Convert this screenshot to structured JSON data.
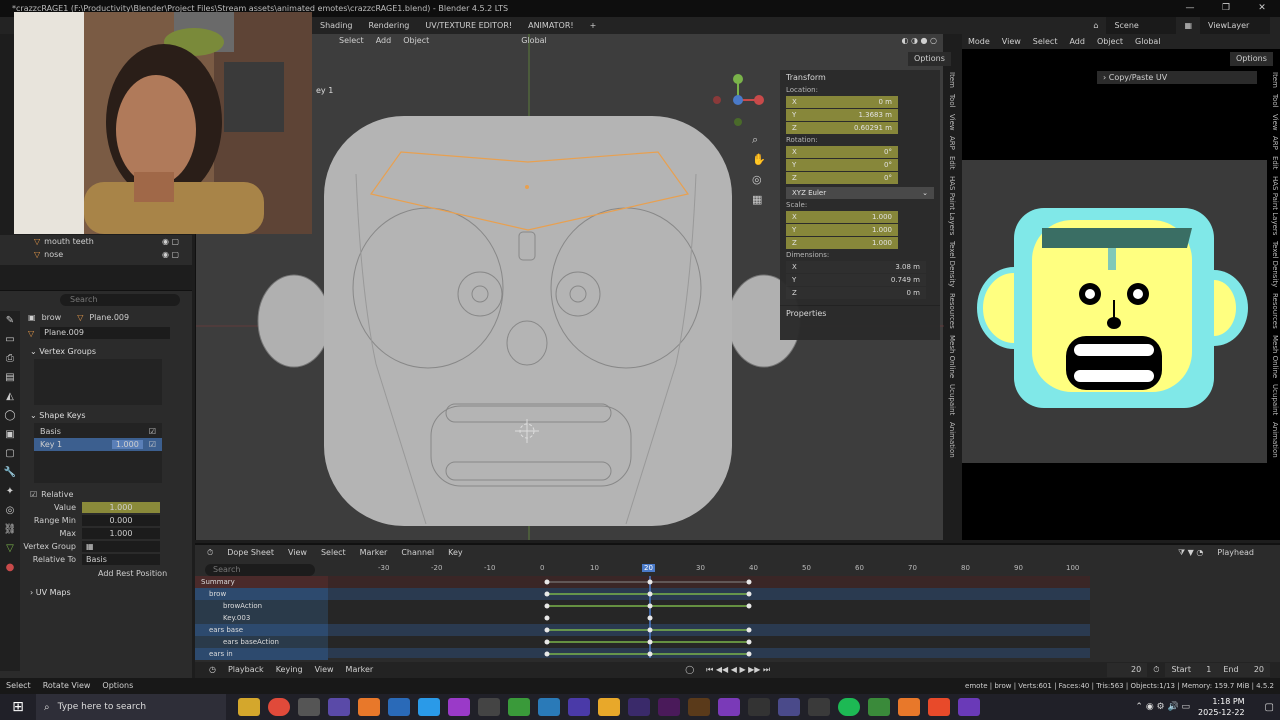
{
  "titlebar": {
    "title": "*crazzcRAGE1 (F:\\Productivity\\Blender\\Project Files\\Stream assets\\animated emotes\\crazzcRAGE1.blend) - Blender 4.5.2 LTS"
  },
  "menubar": {
    "workspaces": [
      "Shading",
      "Rendering",
      "UV/TEXTURE EDITOR!",
      "ANIMATOR!"
    ],
    "scene": "Scene",
    "viewlayer": "ViewLayer"
  },
  "viewport": {
    "header": [
      "Select",
      "Add",
      "Object"
    ],
    "orientation": "Global",
    "options": "Options",
    "key_label": "ey 1"
  },
  "transform": {
    "title": "Transform",
    "location_label": "Location:",
    "location": [
      [
        "X",
        "0 m"
      ],
      [
        "Y",
        "1.3683 m"
      ],
      [
        "Z",
        "0.60291 m"
      ]
    ],
    "rotation_label": "Rotation:",
    "rotation": [
      [
        "X",
        "0°"
      ],
      [
        "Y",
        "0°"
      ],
      [
        "Z",
        "0°"
      ]
    ],
    "rotation_mode": "XYZ Euler",
    "scale_label": "Scale:",
    "scale": [
      [
        "X",
        "1.000"
      ],
      [
        "Y",
        "1.000"
      ],
      [
        "Z",
        "1.000"
      ]
    ],
    "dimensions_label": "Dimensions:",
    "dimensions": [
      [
        "X",
        "3.08 m"
      ],
      [
        "Y",
        "0.749 m"
      ],
      [
        "Z",
        "0 m"
      ]
    ],
    "properties": "Properties"
  },
  "sidebar_tabs": [
    "Item",
    "Tool",
    "View",
    "ARP",
    "Edit",
    "HAS Paint Layers",
    "Texel Density",
    "Resources",
    "Mesh Online",
    "Ucupaint",
    "Animation"
  ],
  "uv": {
    "header": [
      "Mode",
      "View",
      "Select",
      "Add",
      "Object"
    ],
    "orientation": "Global",
    "options": "Options",
    "panel": "Copy/Paste UV",
    "tabs": [
      "Item",
      "Tool",
      "View",
      "ARP",
      "Edit",
      "HAS Paint Layers",
      "Texel Density",
      "Resources",
      "Mesh Online",
      "Ucupaint",
      "Animation"
    ]
  },
  "outliner": {
    "items": [
      {
        "label": "mouth teeth"
      },
      {
        "label": "nose"
      }
    ]
  },
  "props": {
    "search_placeholder": "Search",
    "object": "brow",
    "mesh": "Plane.009",
    "mesh_data": "Plane.009",
    "vertex_groups": "Vertex Groups",
    "shape_keys": "Shape Keys",
    "keys": [
      {
        "name": "Basis",
        "value": ""
      },
      {
        "name": "Key 1",
        "value": "1.000"
      }
    ],
    "relative": "Relative",
    "value_label": "Value",
    "value": "1.000",
    "range_min_label": "Range Min",
    "range_min": "0.000",
    "max_label": "Max",
    "max": "1.000",
    "vertex_group_label": "Vertex Group",
    "relative_to_label": "Relative To",
    "relative_to": "Basis",
    "add_rest": "Add Rest Position",
    "uv_maps": "UV Maps"
  },
  "dope": {
    "editor": "Dope Sheet",
    "menus": [
      "View",
      "Select",
      "Marker",
      "Channel",
      "Key"
    ],
    "search_placeholder": "Search",
    "mode": "Playhead",
    "ruler": [
      "-30",
      "-20",
      "-10",
      "0",
      "10",
      "20",
      "30",
      "40",
      "50",
      "60",
      "70",
      "80",
      "90",
      "100"
    ],
    "current_frame": "20",
    "channels": [
      {
        "label": "Summary",
        "kind": "summary"
      },
      {
        "label": "brow",
        "kind": "object"
      },
      {
        "label": "browAction",
        "kind": "action"
      },
      {
        "label": "Key.003",
        "kind": "action"
      },
      {
        "label": "ears base",
        "kind": "object"
      },
      {
        "label": "ears baseAction",
        "kind": "action"
      },
      {
        "label": "ears in",
        "kind": "object"
      }
    ]
  },
  "timeline": {
    "menus": [
      "Playback",
      "Keying",
      "View",
      "Marker"
    ],
    "frame": "20",
    "start_label": "Start",
    "start": "1",
    "end_label": "End",
    "end": "20"
  },
  "status": {
    "left": [
      "Select",
      "Rotate View",
      "Options"
    ],
    "right": "emote | brow | Verts:601 | Faces:40 | Tris:563 | Objects:1/13 | Memory: 159.7 MiB | 4.5.2"
  },
  "taskbar": {
    "search_placeholder": "Type here to search",
    "time": "1:18 PM",
    "date": "2025-12-22"
  }
}
